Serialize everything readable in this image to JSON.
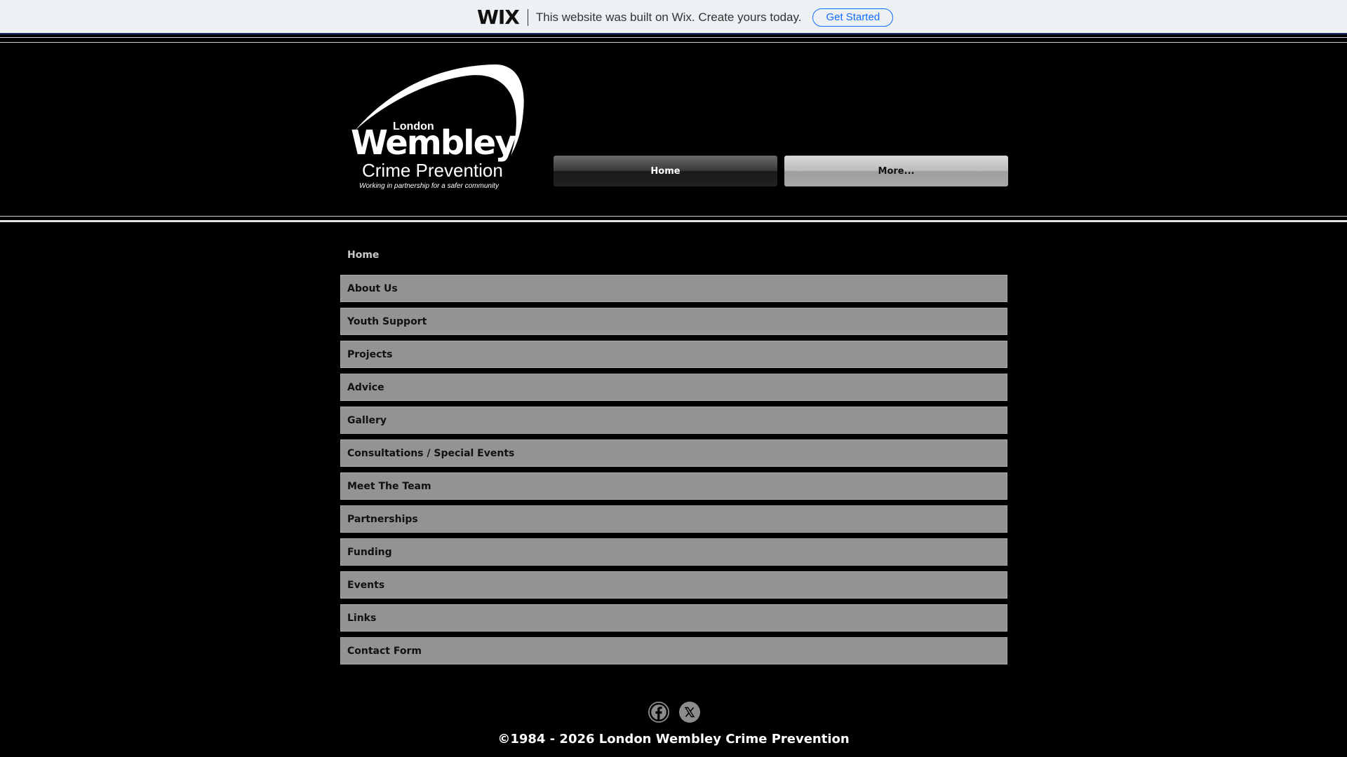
{
  "wix_banner": {
    "logo": "WIX",
    "message": "This website was built on Wix. Create yours today.",
    "cta_label": "Get Started"
  },
  "site_logo": {
    "line1": "London",
    "line2": "Wembley",
    "line3": "Crime Prevention",
    "tagline": "Working in partnership for a safer community"
  },
  "top_nav": {
    "home_label": "Home",
    "more_label": "More..."
  },
  "page_menu": {
    "title": "Home",
    "items": [
      "About Us",
      "Youth Support",
      "Projects",
      "Advice",
      "Gallery",
      "Consultations / Special Events",
      "Meet The Team",
      "Partnerships",
      "Funding",
      "Events",
      "Links",
      "Contact Form"
    ]
  },
  "footer": {
    "socials": [
      "facebook-icon",
      "x-twitter-icon"
    ],
    "copyright": "©1984 - 2026 London Wembley Crime Prevention"
  },
  "colors": {
    "background": "#000000",
    "menu_item_bg": "#939393",
    "wix_accent": "#116dff"
  }
}
